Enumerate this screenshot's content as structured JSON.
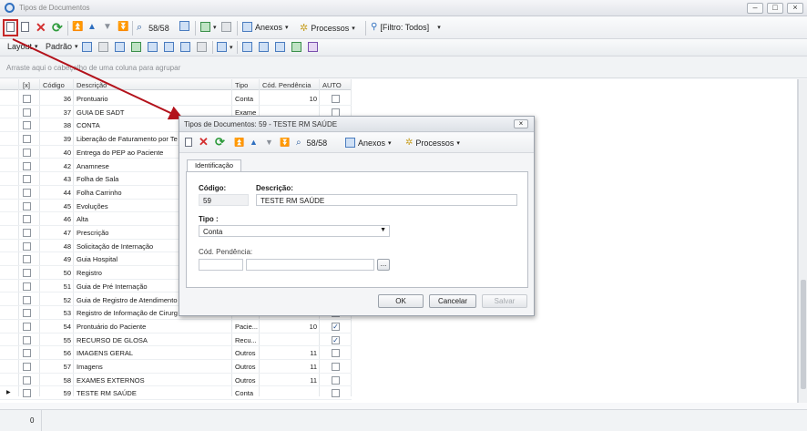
{
  "window": {
    "title": "Tipos de Documentos"
  },
  "toolbar": {
    "record_counter": "58/58",
    "attachments_label": "Anexos",
    "processes_label": "Processos",
    "filter_label": "[Filtro: Todos]"
  },
  "toolbar2": {
    "layout_label": "Layout",
    "standard_label": "Padrão"
  },
  "group_hint": "Arraste aqui o cabeçalho de uma coluna para agrupar",
  "grid": {
    "columns": [
      "[x]",
      "Código",
      "Descrição",
      "Tipo",
      "Cód. Pendência",
      "AUTO"
    ],
    "rows": [
      {
        "code": "36",
        "desc": "Prontuario",
        "type": "Conta",
        "pend": "10",
        "auto": false
      },
      {
        "code": "37",
        "desc": "GUIA DE SADT",
        "type": "Exame",
        "pend": "",
        "auto": false
      },
      {
        "code": "38",
        "desc": "CONTA",
        "type": "",
        "pend": "",
        "auto": false
      },
      {
        "code": "39",
        "desc": "Liberação de Faturamento por Te",
        "type": "",
        "pend": "",
        "auto": false
      },
      {
        "code": "40",
        "desc": "Entrega do PEP ao Paciente",
        "type": "",
        "pend": "",
        "auto": false
      },
      {
        "code": "42",
        "desc": "Anamnese",
        "type": "",
        "pend": "",
        "auto": false
      },
      {
        "code": "43",
        "desc": "Folha de Sala",
        "type": "",
        "pend": "",
        "auto": false
      },
      {
        "code": "44",
        "desc": "Folha Carrinho",
        "type": "",
        "pend": "",
        "auto": false
      },
      {
        "code": "45",
        "desc": "Evoluções",
        "type": "",
        "pend": "",
        "auto": false
      },
      {
        "code": "46",
        "desc": "Alta",
        "type": "",
        "pend": "",
        "auto": false
      },
      {
        "code": "47",
        "desc": "Prescrição",
        "type": "",
        "pend": "",
        "auto": false
      },
      {
        "code": "48",
        "desc": "Solicitação de Internação",
        "type": "",
        "pend": "",
        "auto": false
      },
      {
        "code": "49",
        "desc": "Guia Hospital",
        "type": "",
        "pend": "",
        "auto": false
      },
      {
        "code": "50",
        "desc": "Registro",
        "type": "",
        "pend": "",
        "auto": false
      },
      {
        "code": "51",
        "desc": "Guia de Pré Internação",
        "type": "",
        "pend": "",
        "auto": false
      },
      {
        "code": "52",
        "desc": "Guia de Registro de Atendimento",
        "type": "",
        "pend": "",
        "auto": false
      },
      {
        "code": "53",
        "desc": "Registro de Informação de Cirurg",
        "type": "",
        "pend": "",
        "auto": false
      },
      {
        "code": "54",
        "desc": "Prontuário do Paciente",
        "type": "Pacie...",
        "pend": "10",
        "auto": true
      },
      {
        "code": "55",
        "desc": "RECURSO DE GLOSA",
        "type": "Recu...",
        "pend": "",
        "auto": true
      },
      {
        "code": "56",
        "desc": "IMAGENS GERAL",
        "type": "Outros",
        "pend": "11",
        "auto": false
      },
      {
        "code": "57",
        "desc": "Imagens",
        "type": "Outros",
        "pend": "11",
        "auto": false
      },
      {
        "code": "58",
        "desc": "EXAMES EXTERNOS",
        "type": "Outros",
        "pend": "11",
        "auto": false
      },
      {
        "code": "59",
        "desc": "TESTE RM SAÚDE",
        "type": "Conta",
        "pend": "",
        "auto": false
      }
    ]
  },
  "footer": {
    "count": "0"
  },
  "dialog": {
    "title": "Tipos de Documentos: 59 - TESTE RM SAÚDE",
    "record_counter": "58/58",
    "attachments_label": "Anexos",
    "processes_label": "Processos",
    "tab_label": "Identificação",
    "code_label": "Código:",
    "code_value": "59",
    "desc_label": "Descrição:",
    "desc_value": "TESTE RM SAÚDE",
    "type_label": "Tipo :",
    "type_value": "Conta",
    "pend_label": "Cód. Pendência:",
    "pend_btn": "...",
    "ok_label": "OK",
    "cancel_label": "Cancelar",
    "save_label": "Salvar"
  },
  "colors": {
    "accent": "#2f6fbf",
    "arrow": "#b3121b",
    "delete": "#d32f2f",
    "refresh": "#2e9b3c"
  }
}
